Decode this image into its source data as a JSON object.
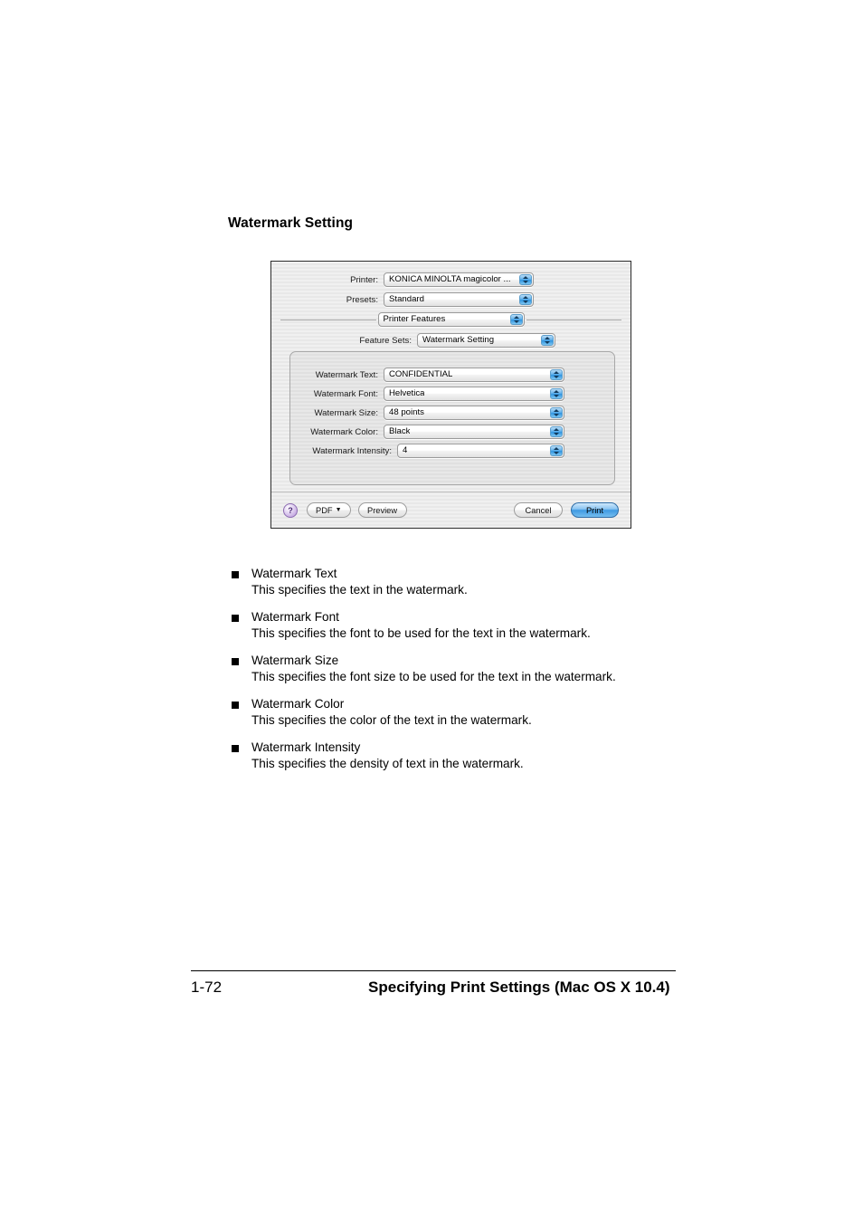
{
  "page": {
    "heading": "Watermark Setting"
  },
  "dialog": {
    "printer": {
      "label": "Printer:",
      "value": "KONICA MINOLTA magicolor ..."
    },
    "presets": {
      "label": "Presets:",
      "value": "Standard"
    },
    "pane": {
      "value": "Printer Features"
    },
    "feature_sets": {
      "label": "Feature Sets:",
      "value": "Watermark Setting"
    },
    "settings": [
      {
        "label": "Watermark Text:",
        "value": "CONFIDENTIAL"
      },
      {
        "label": "Watermark Font:",
        "value": "Helvetica"
      },
      {
        "label": "Watermark Size:",
        "value": "48 points"
      },
      {
        "label": "Watermark Color:",
        "value": "Black"
      },
      {
        "label": "Watermark Intensity:",
        "value": "4"
      }
    ],
    "buttons": {
      "help": "?",
      "pdf": "PDF",
      "pdf_caret": "▼",
      "preview": "Preview",
      "cancel": "Cancel",
      "print": "Print"
    },
    "colors": {
      "accent_blue": "#3f9ae2",
      "help_purple": "#b491d8",
      "dialog_bg": "#ededed",
      "group_bg": "#e4e4e4"
    }
  },
  "descriptions": [
    {
      "title": "Watermark Text",
      "text": "This specifies the text in the watermark."
    },
    {
      "title": "Watermark Font",
      "text": "This specifies the font to be used for the text in the watermark."
    },
    {
      "title": "Watermark Size",
      "text": "This specifies the font size to be used for the text in the watermark."
    },
    {
      "title": "Watermark Color",
      "text": "This specifies the color of the text in the watermark."
    },
    {
      "title": "Watermark Intensity",
      "text": "This specifies the density of text in the watermark."
    }
  ],
  "footer": {
    "page_number": "1-72",
    "title": "Specifying Print Settings (Mac OS X 10.4)"
  }
}
